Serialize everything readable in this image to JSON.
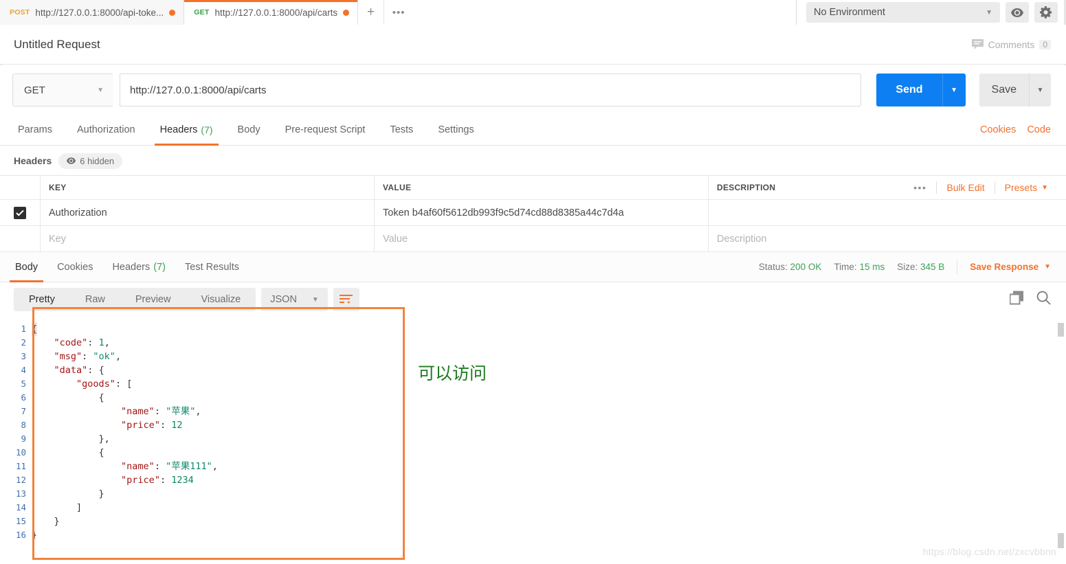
{
  "tabs": [
    {
      "method": "POST",
      "url": "http://127.0.0.1:8000/api-toke...",
      "active": false,
      "unsaved_icon": "unsaved-dot"
    },
    {
      "method": "GET",
      "url": "http://127.0.0.1:8000/api/carts",
      "active": true,
      "unsaved_icon": "unsaved-dot"
    }
  ],
  "tabbar": {
    "new_tab_label": "+",
    "more_label": "•••"
  },
  "environment": {
    "selected": "No Environment",
    "caret": "▼",
    "eye_icon": "eye-icon",
    "gear_icon": "gear-icon"
  },
  "request": {
    "title": "Untitled Request",
    "comments_label": "Comments",
    "comments_count": "0",
    "method": "GET",
    "url": "http://127.0.0.1:8000/api/carts",
    "send_label": "Send",
    "save_label": "Save",
    "caret": "▼"
  },
  "request_tabs": [
    {
      "label": "Params",
      "count": "",
      "active": false
    },
    {
      "label": "Authorization",
      "count": "",
      "active": false
    },
    {
      "label": "Headers",
      "count": "(7)",
      "active": true
    },
    {
      "label": "Body",
      "count": "",
      "active": false
    },
    {
      "label": "Pre-request Script",
      "count": "",
      "active": false
    },
    {
      "label": "Tests",
      "count": "",
      "active": false
    },
    {
      "label": "Settings",
      "count": "",
      "active": false
    }
  ],
  "request_tabs_right": [
    {
      "label": "Cookies"
    },
    {
      "label": "Code"
    }
  ],
  "headers_section": {
    "label": "Headers",
    "hidden_pill": "6 hidden",
    "eye_icon": "eye-icon",
    "columns": [
      "KEY",
      "VALUE",
      "DESCRIPTION"
    ],
    "rows": [
      {
        "checked": true,
        "key": "Authorization",
        "value": "Token b4af60f5612db993f9c5d74cd88d8385a44c7d4a",
        "description": ""
      }
    ],
    "placeholder_row": {
      "key": "Key",
      "value": "Value",
      "description": "Description"
    },
    "actions": {
      "dots": "•••",
      "bulk_edit": "Bulk Edit",
      "presets": "Presets",
      "presets_caret": "▼"
    }
  },
  "response_tabs": [
    {
      "label": "Body",
      "count": "",
      "active": true
    },
    {
      "label": "Cookies",
      "count": "",
      "active": false
    },
    {
      "label": "Headers",
      "count": "(7)",
      "active": false
    },
    {
      "label": "Test Results",
      "count": "",
      "active": false
    }
  ],
  "response_meta": {
    "status_label": "Status:",
    "status_value": "200 OK",
    "time_label": "Time:",
    "time_value": "15 ms",
    "size_label": "Size:",
    "size_value": "345 B",
    "save_response": "Save Response",
    "save_response_caret": "▼"
  },
  "format_bar": {
    "views": [
      {
        "label": "Pretty",
        "active": true
      },
      {
        "label": "Raw",
        "active": false
      },
      {
        "label": "Preview",
        "active": false
      },
      {
        "label": "Visualize",
        "active": false
      }
    ],
    "language": "JSON",
    "language_caret": "▼",
    "wrap_icon": "text-wrap-icon",
    "copy_icon": "copy-icon",
    "search_icon": "search-icon"
  },
  "response_body": {
    "language": "json",
    "lines": [
      {
        "n": "1",
        "text": "{"
      },
      {
        "n": "2",
        "text": "    \"code\": 1,"
      },
      {
        "n": "3",
        "text": "    \"msg\": \"ok\","
      },
      {
        "n": "4",
        "text": "    \"data\": {"
      },
      {
        "n": "5",
        "text": "        \"goods\": ["
      },
      {
        "n": "6",
        "text": "            {"
      },
      {
        "n": "7",
        "text": "                \"name\": \"苹果\","
      },
      {
        "n": "8",
        "text": "                \"price\": 12"
      },
      {
        "n": "9",
        "text": "            },"
      },
      {
        "n": "10",
        "text": "            {"
      },
      {
        "n": "11",
        "text": "                \"name\": \"苹果111\","
      },
      {
        "n": "12",
        "text": "                \"price\": 1234"
      },
      {
        "n": "13",
        "text": "            }"
      },
      {
        "n": "14",
        "text": "        ]"
      },
      {
        "n": "15",
        "text": "    }"
      },
      {
        "n": "16",
        "text": "}"
      }
    ]
  },
  "annotations": {
    "note_text": "可以访问",
    "note_color": "#1f7a1f",
    "box_color": "#f4823c"
  },
  "watermark": "https://blog.csdn.net/zxcvbbnn",
  "colors": {
    "accent_orange": "#f4712b",
    "send_blue": "#0d7ff2",
    "status_green": "#3aa357",
    "method_get": "#2f9e44",
    "method_post": "#e8a33d"
  }
}
